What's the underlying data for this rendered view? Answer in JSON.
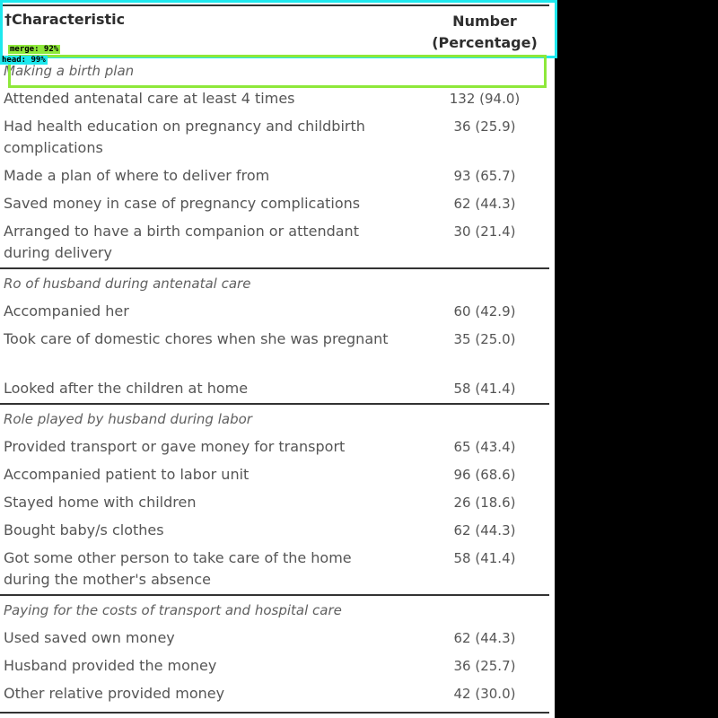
{
  "table": {
    "header": {
      "characteristic": "†Characteristic",
      "number": "Number (Percentage)"
    },
    "sections": [
      {
        "title": "Making a birth plan",
        "rows": [
          {
            "label": "Attended antenatal care at least 4 times",
            "value": "132 (94.0)"
          },
          {
            "label": "Had health education on pregnancy and childbirth complications",
            "value": "36 (25.9)"
          },
          {
            "label": "Made a plan of where to deliver from",
            "value": "93 (65.7)"
          },
          {
            "label": "Saved money in case of pregnancy complications",
            "value": "62 (44.3)"
          },
          {
            "label": "Arranged to have a birth companion or attendant during delivery",
            "value": "30 (21.4)"
          }
        ]
      },
      {
        "title": "Ro of husband during antenatal care",
        "rows": [
          {
            "label": "Accompanied her",
            "value": "60 (42.9)"
          },
          {
            "label": "Took care of domestic chores when she was pregnant",
            "value": "35 (25.0)"
          },
          {
            "label": "Looked after the children at home",
            "value": "58 (41.4)"
          }
        ]
      },
      {
        "title": "Role played by husband during labor",
        "rows": [
          {
            "label": "Provided transport or gave money for transport",
            "value": "65 (43.4)"
          },
          {
            "label": "Accompanied patient to labor unit",
            "value": "96 (68.6)"
          },
          {
            "label": "Stayed home with children",
            "value": "26 (18.6)"
          },
          {
            "label": "Bought baby/s clothes",
            "value": "62 (44.3)"
          },
          {
            "label": "Got some other person to take care of the home during the mother's absence",
            "value": "58 (41.4)"
          }
        ]
      },
      {
        "title": "Paying for the costs of transport and hospital care",
        "rows": [
          {
            "label": "Used saved own money",
            "value": "62 (44.3)"
          },
          {
            "label": "Husband provided the money",
            "value": "36 (25.7)"
          },
          {
            "label": "Other relative provided money",
            "value": "42 (30.0)"
          }
        ]
      }
    ]
  },
  "overlay": {
    "merge_tag": "merge: 92%",
    "head_tag": "head: 99%",
    "colors": {
      "head_box": "#1ee8ee",
      "merge_box": "#8ee83a"
    }
  }
}
